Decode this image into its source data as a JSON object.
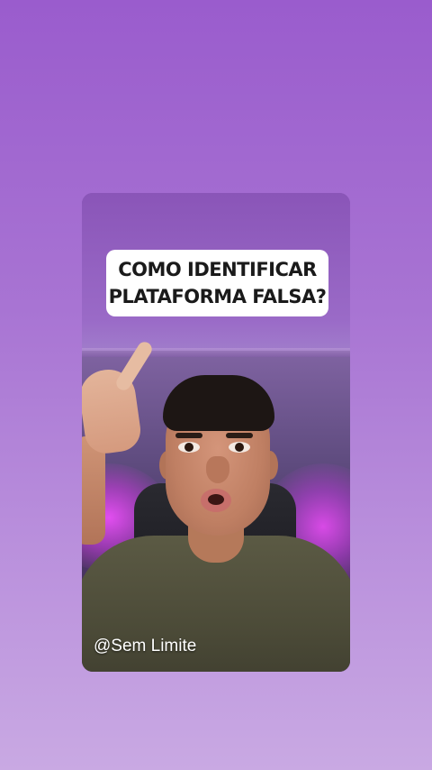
{
  "caption": {
    "line1": "COMO IDENTIFICAR",
    "line2": "PLATAFORMA FALSA?"
  },
  "watermark": {
    "text": "@Sem Limite"
  },
  "colors": {
    "background_top": "#9a5ccd",
    "background_bottom": "#c9a9e3",
    "caption_bg": "#ffffff",
    "caption_text": "#1a1a1a"
  }
}
